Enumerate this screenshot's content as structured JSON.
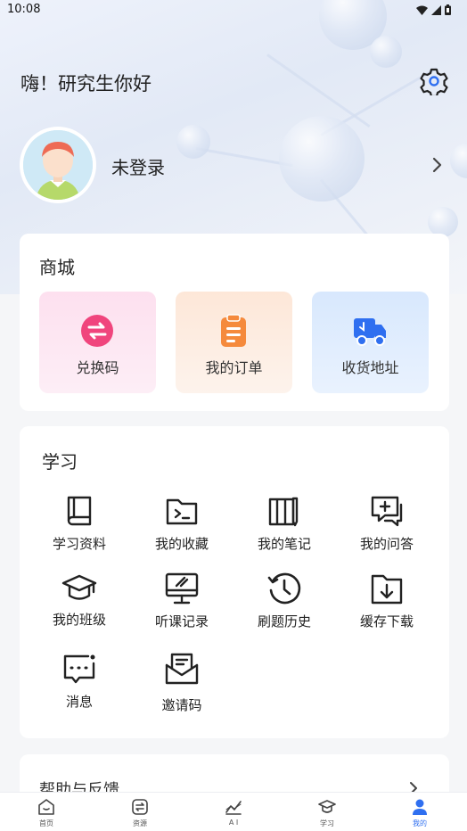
{
  "status_bar": {
    "time": "10:08"
  },
  "header": {
    "greeting": "嗨！研究生你好"
  },
  "profile": {
    "login_status": "未登录"
  },
  "mall": {
    "title": "商城",
    "items": [
      {
        "label": "兑换码",
        "icon": "exchange-code-icon",
        "bg": "#fde4f0",
        "color": "#f0457d"
      },
      {
        "label": "我的订单",
        "icon": "order-clipboard-icon",
        "bg": "#fdeee2",
        "color": "#f58a3c"
      },
      {
        "label": "收货地址",
        "icon": "delivery-truck-icon",
        "bg": "#dcebfd",
        "color": "#2f6ff0"
      }
    ]
  },
  "study": {
    "title": "学习",
    "items": [
      {
        "label": "学习资料",
        "icon": "book-icon"
      },
      {
        "label": "我的收藏",
        "icon": "folder-icon"
      },
      {
        "label": "我的笔记",
        "icon": "notes-icon"
      },
      {
        "label": "我的问答",
        "icon": "qa-icon"
      },
      {
        "label": "我的班级",
        "icon": "graduation-cap-icon"
      },
      {
        "label": "听课记录",
        "icon": "monitor-icon"
      },
      {
        "label": "刷题历史",
        "icon": "history-icon"
      },
      {
        "label": "缓存下载",
        "icon": "download-folder-icon"
      },
      {
        "label": "消息",
        "icon": "message-icon"
      },
      {
        "label": "邀请码",
        "icon": "invite-envelope-icon"
      }
    ]
  },
  "help": {
    "title": "帮助与反馈"
  },
  "bottom_nav": {
    "items": [
      {
        "label": "首页",
        "icon": "home-icon"
      },
      {
        "label": "资源",
        "icon": "resources-icon"
      },
      {
        "label": "A I",
        "icon": "ai-chart-icon"
      },
      {
        "label": "学习",
        "icon": "study-cap-icon"
      },
      {
        "label": "我的",
        "icon": "profile-icon"
      }
    ],
    "active": "我的",
    "accent": "#2f6ff0"
  }
}
